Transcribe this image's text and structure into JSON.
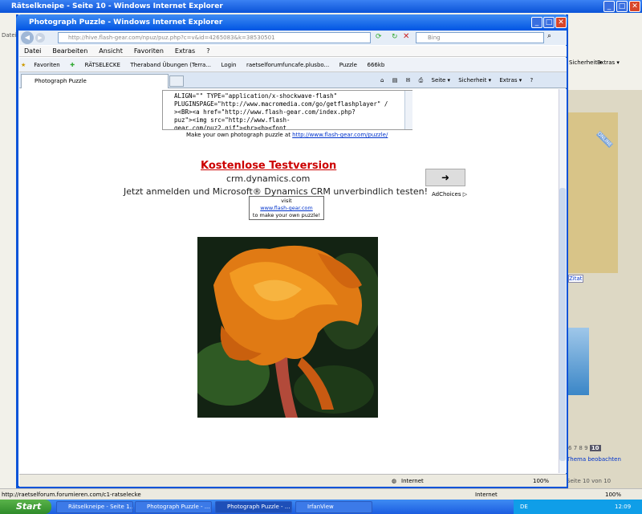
{
  "bg_window": {
    "title": "Rätselkneipe - Seite 10 - Windows Internet Explorer",
    "menu_fragment": "Datei",
    "right_menu": [
      "Sicherheit ▾",
      "Extras ▾"
    ],
    "panel_texts": [
      "Zitat",
      "ONLINE"
    ],
    "pagination": [
      "6",
      "7",
      "8",
      "9",
      "10"
    ],
    "watch_text": "Thema beobachten",
    "page_info": "Seite 10 von 10",
    "status_url": "http://raetselforum.forumieren.com/c1-ratselecke",
    "status_zone": "Internet",
    "status_zoom": "100%"
  },
  "fg_window": {
    "title": "Photograph Puzzle - Windows Internet Explorer",
    "address": "http://hive.flash-gear.com/npuz/puz.php?c=v&id=4265083&k=38530501",
    "search_placeholder": "Bing",
    "menu": [
      "Datei",
      "Bearbeiten",
      "Ansicht",
      "Favoriten",
      "Extras",
      "?"
    ],
    "favorites_label": "Favoriten",
    "favorites": [
      "RÄTSELECKE",
      "Theraband Übungen (Terra...",
      "Login",
      "raetselforumfuncafe.plusbo...",
      "Puzzle",
      "666kb"
    ],
    "tab_label": "Photograph Puzzle",
    "commands": [
      "Seite ▾",
      "Sicherheit ▾",
      "Extras ▾"
    ],
    "status_zone": "Internet",
    "status_zoom": "100%"
  },
  "page": {
    "code_text": "ALIGN=\"\" TYPE=\"application/x-shockwave-flash\"\nPLUGINSPAGE=\"http://www.macromedia.com/go/getflashplayer\" /\n><BR><a href=\"http://www.flash-gear.com/index.php?\npuz\"><img src=\"http://www.flash-\ngear.com/puz2.gif\"><br><b><font",
    "make_own_prefix": "Make your own photograph puzzle at ",
    "make_own_link": "http://www.flash-gear.com/puzzle/",
    "ad_title": "Kostenlose Testversion",
    "ad_domain": "crm.dynamics.com",
    "ad_text": "Jetzt anmelden und Microsoft® Dynamics CRM unverbindlich testen!",
    "ad_choices": "AdChoices",
    "visit_label": "visit",
    "visit_link": "www.flash-gear.com",
    "visit_suffix": "to make your own puzzle!"
  },
  "taskbar": {
    "start": "Start",
    "tasks": [
      "Rätselkneipe - Seite 1...",
      "Photograph Puzzle - ...",
      "Photograph Puzzle - ...",
      "IrfanView"
    ],
    "lang": "DE",
    "clock": "12:09"
  },
  "colors": {
    "accent": "#0054e3",
    "ad_title": "#cc0000",
    "link": "#0033cc"
  }
}
